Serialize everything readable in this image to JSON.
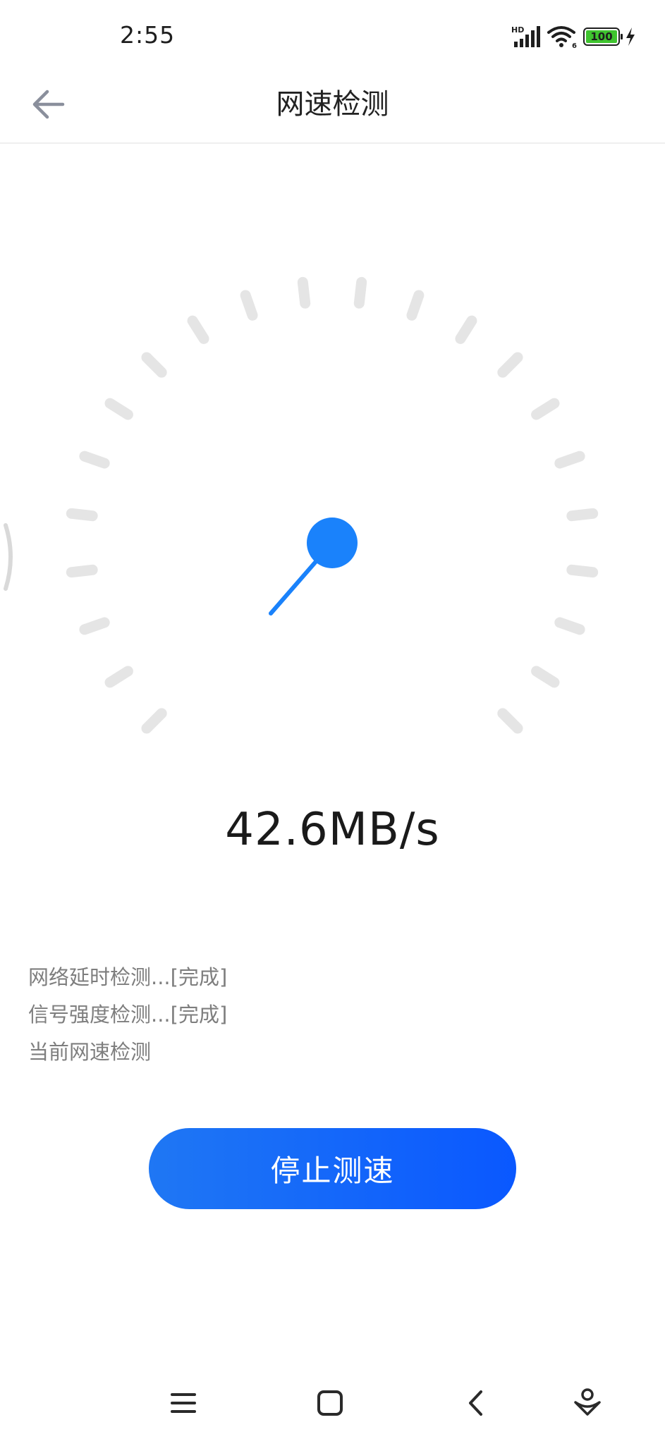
{
  "status_bar": {
    "time": "2:55",
    "network_label": "HD",
    "wifi_badge": "6",
    "battery_level": "100"
  },
  "header": {
    "title": "网速检测"
  },
  "gauge": {
    "needle_color": "#1a82fb",
    "tick_color": "#e5e5e5"
  },
  "speed": {
    "value": "42.6MB/s"
  },
  "log": [
    "网络延时检测...[完成]",
    "信号强度检测...[完成]",
    "当前网速检测"
  ],
  "actions": {
    "stop_label": "停止测速"
  },
  "nav": {
    "menu": "menu-icon",
    "home": "square-icon",
    "back": "back-icon",
    "assistant": "assistant-icon"
  }
}
